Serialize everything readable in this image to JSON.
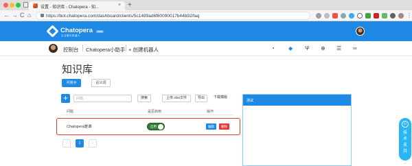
{
  "browser": {
    "tab_title": "设置 - 知识库 - Chatopera - 知...",
    "tab_close": "×",
    "new_tab": "+",
    "url": "https://bot.chatopera.com/dashboard/clients/5c1489ad6f80090017b44b92/faq",
    "back": "←",
    "forward": "→",
    "reload": "C",
    "home": "⌂",
    "traffic_colors": [
      "#ff5f57",
      "#febc2e",
      "#28c840"
    ]
  },
  "header": {
    "brand": "Chatopera",
    "brand_tag": "beta",
    "brand_sub": "企业聊天机器人",
    "accent": "#1e88e5"
  },
  "subnav": {
    "crumbs": [
      "控制台",
      "Chatopera小助手",
      "+ 创建机器人"
    ]
  },
  "page": {
    "title": "知识库",
    "tabs": [
      "问答对",
      "近义词"
    ],
    "search_placeholder": "问题",
    "search_button": "搜索",
    "upload_button": "上传.xlsx文件",
    "export_button": "导出",
    "template_button": "下载模版",
    "columns": [
      "问题",
      "是否启用",
      "操作"
    ],
    "rows": [
      {
        "question": "Chatopera是谁",
        "enabled_label": "启用",
        "edit": "编辑",
        "delete": "删除"
      }
    ],
    "pagination": [
      "‹",
      "1",
      "›"
    ]
  },
  "test_panel": {
    "title": "测试"
  },
  "support": {
    "icon": "☺",
    "label": "技术支持"
  }
}
